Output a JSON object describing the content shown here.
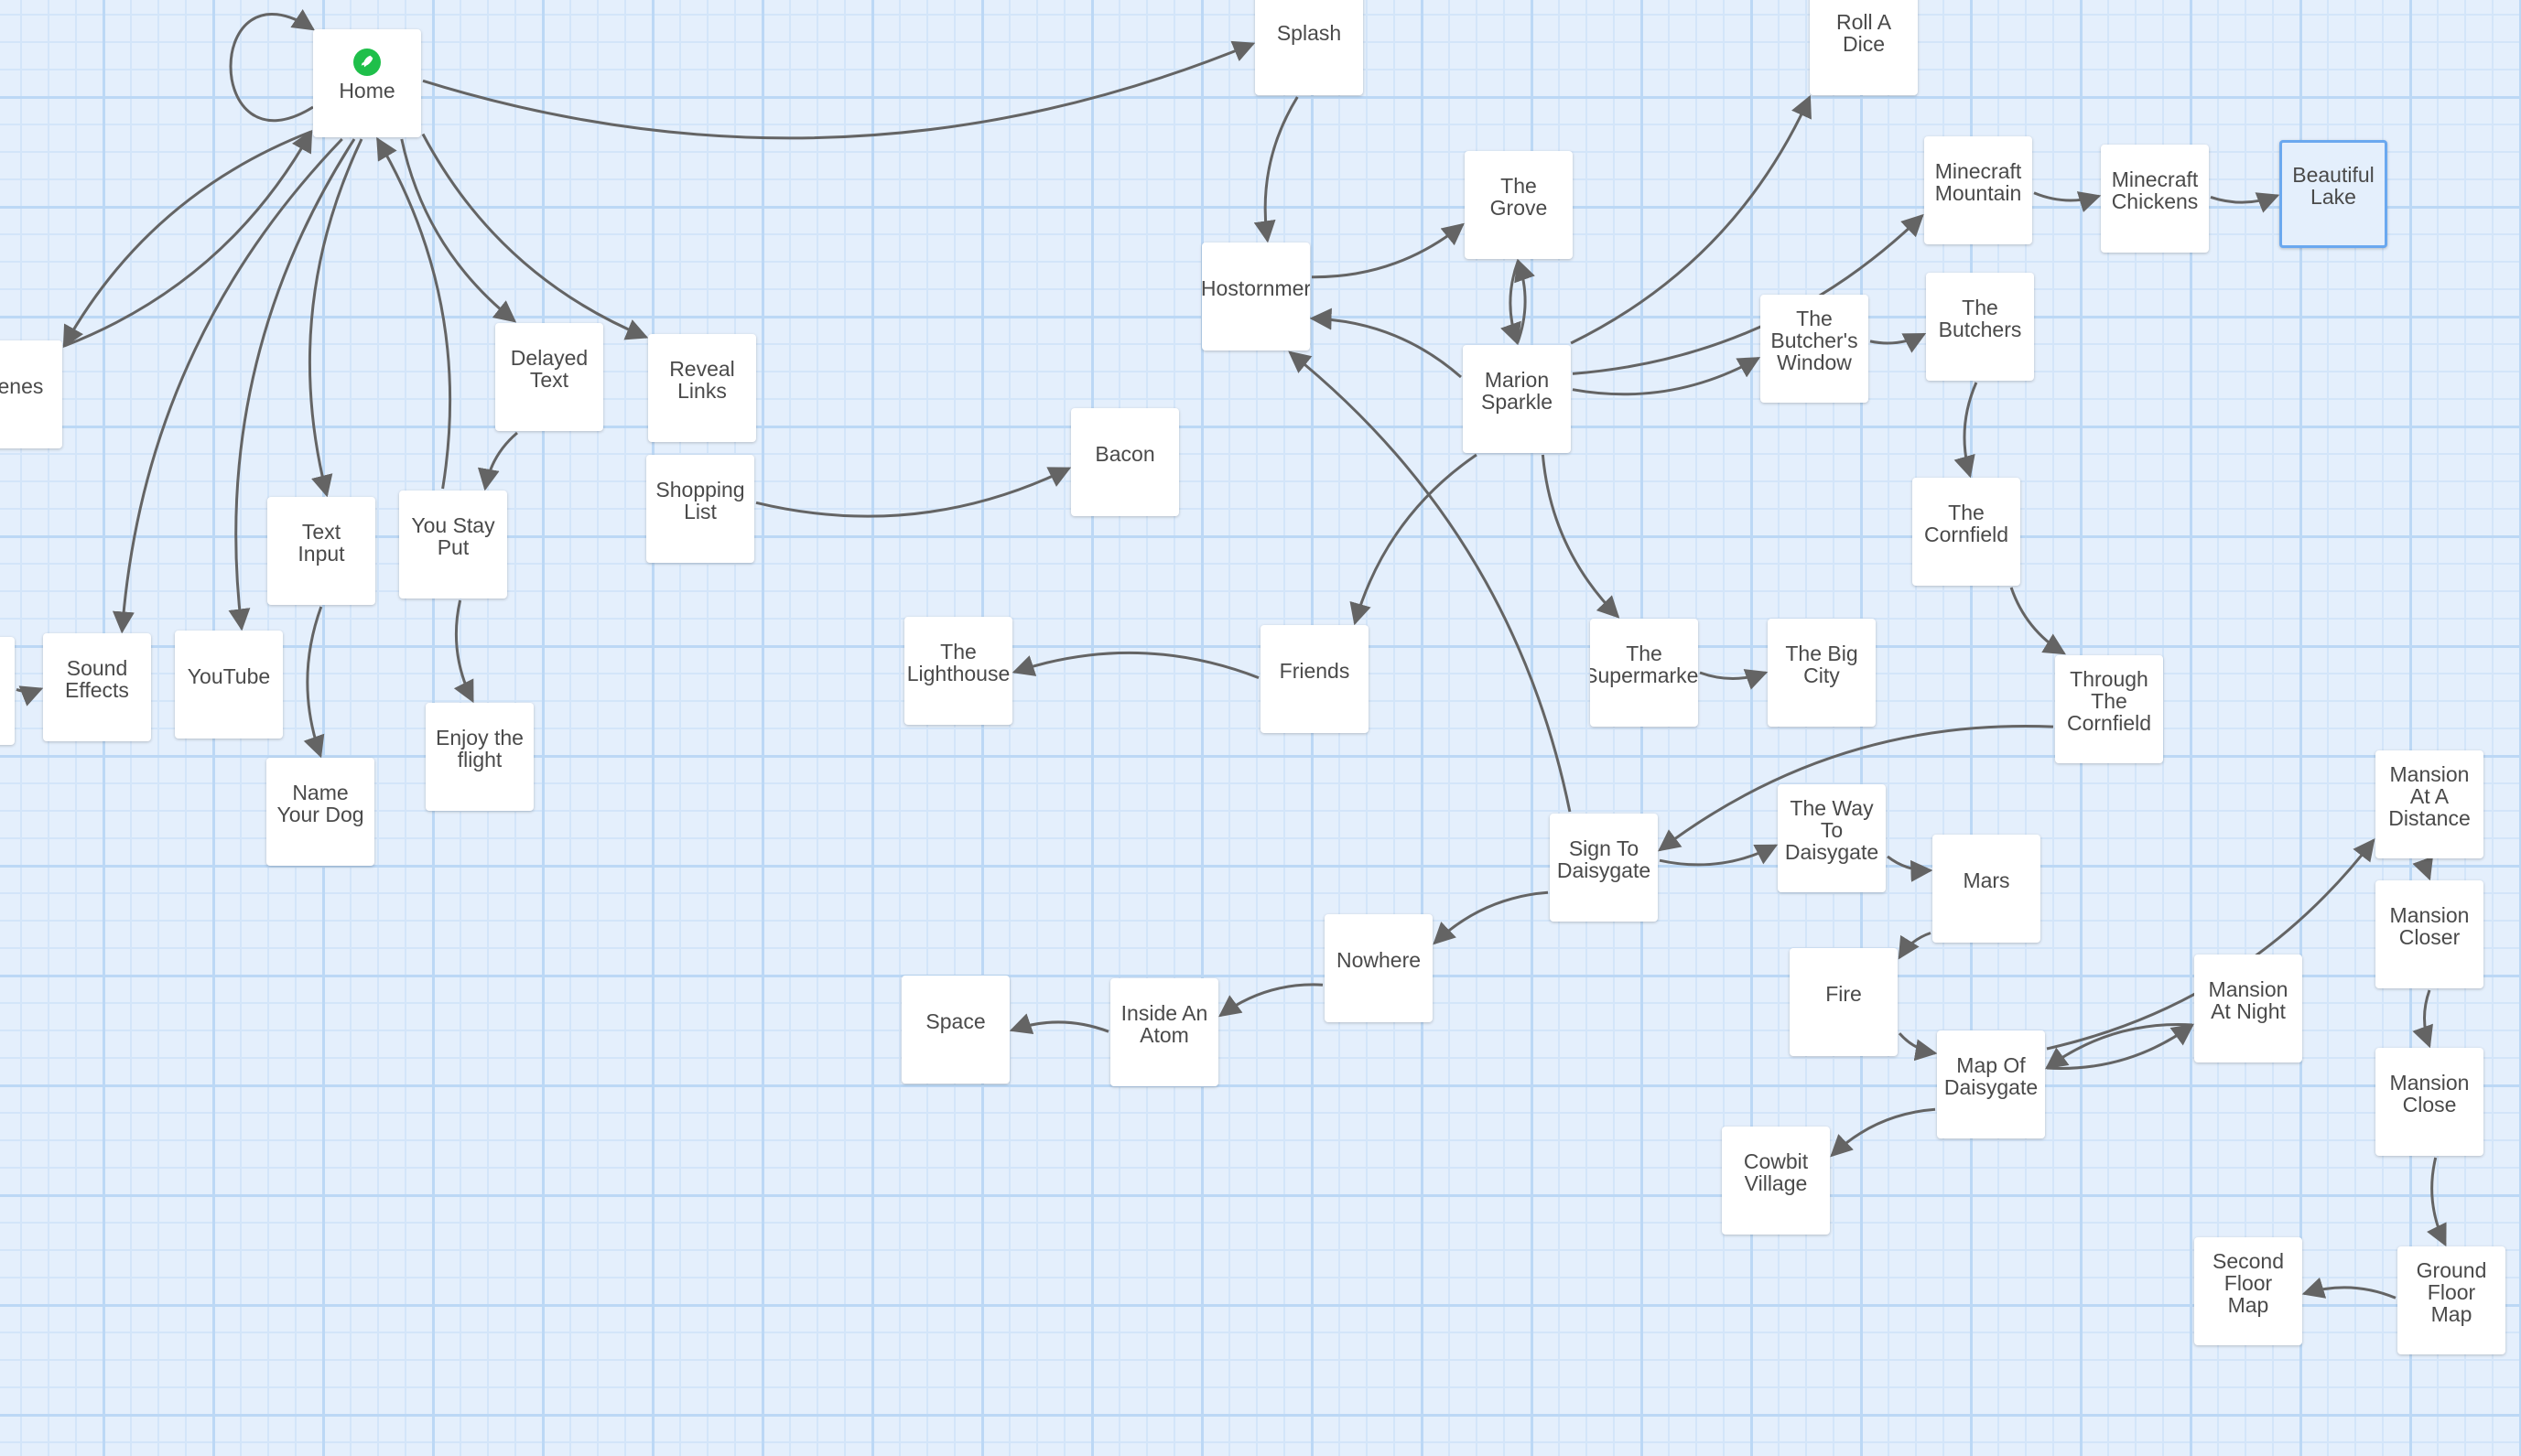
{
  "app": "Twine story map",
  "start_passage": "Home",
  "selected_passage": "Beautiful Lake",
  "colors": {
    "background": "#e4effc",
    "grid_major": "#bcd8f5",
    "grid_minor": "#d3e5f9",
    "node_fill": "#ffffff",
    "node_text": "#4a4a4a",
    "edge": "#646464",
    "selected_border": "#6aa8ef",
    "start_icon": "#1fbf4a"
  },
  "passages": [
    {
      "id": "home",
      "label": "Home",
      "start": true
    },
    {
      "id": "splash",
      "label": "Splash"
    },
    {
      "id": "roll-a-dice",
      "label": "Roll A\nDice"
    },
    {
      "id": "the-grove",
      "label": "The\nGrove"
    },
    {
      "id": "hostornme",
      "label": "Hostornmer"
    },
    {
      "id": "minecraft-mountain",
      "label": "Minecraft\nMountain"
    },
    {
      "id": "minecraft-chickens",
      "label": "Minecraft\nChickens"
    },
    {
      "id": "beautiful-lake",
      "label": "Beautiful\nLake",
      "selected": true
    },
    {
      "id": "marion-sparkle",
      "label": "Marion\nSparkle"
    },
    {
      "id": "butchers-window",
      "label": "The\nButcher's\nWindow"
    },
    {
      "id": "the-butchers",
      "label": "The\nButchers"
    },
    {
      "id": "the-cornfield",
      "label": "The\nCornfield"
    },
    {
      "id": "through-the-cornfield",
      "label": "Through\nThe\nCornfield"
    },
    {
      "id": "delayed-text",
      "label": "Delayed\nText"
    },
    {
      "id": "reveal-links",
      "label": "Reveal\nLinks"
    },
    {
      "id": "shopping-list",
      "label": "Shopping\nList"
    },
    {
      "id": "bacon",
      "label": "Bacon"
    },
    {
      "id": "scenes",
      "label": "Scenes"
    },
    {
      "id": "text-input",
      "label": "Text\nInput"
    },
    {
      "id": "you-stay-put",
      "label": "You Stay\nPut"
    },
    {
      "id": "enjoy-the-flight",
      "label": "Enjoy the\nflight"
    },
    {
      "id": "name-your-dog",
      "label": "Name\nYour Dog"
    },
    {
      "id": "sound-effects",
      "label": "Sound\nEffects"
    },
    {
      "id": "youtube",
      "label": "YouTube"
    },
    {
      "id": "left-offscreen",
      "label": ""
    },
    {
      "id": "the-lighthouse",
      "label": "The\nLighthouse"
    },
    {
      "id": "friends",
      "label": "Friends"
    },
    {
      "id": "the-supermarket",
      "label": "The\nSupermarket"
    },
    {
      "id": "the-big-city",
      "label": "The Big\nCity"
    },
    {
      "id": "sign-to-daisygate",
      "label": "Sign To\nDaisygate"
    },
    {
      "id": "way-to-daisygate",
      "label": "The Way\nTo\nDaisygate"
    },
    {
      "id": "mars",
      "label": "Mars"
    },
    {
      "id": "nowhere",
      "label": "Nowhere"
    },
    {
      "id": "inside-an-atom",
      "label": "Inside An\nAtom"
    },
    {
      "id": "space",
      "label": "Space"
    },
    {
      "id": "fire",
      "label": "Fire"
    },
    {
      "id": "map-of-daisygate",
      "label": "Map Of\nDaisygate"
    },
    {
      "id": "mansion-at-night",
      "label": "Mansion\nAt Night"
    },
    {
      "id": "cowbit-village",
      "label": "Cowbit\nVillage"
    },
    {
      "id": "mansion-at-a-distance",
      "label": "Mansion\nAt A\nDistance"
    },
    {
      "id": "mansion-closer",
      "label": "Mansion\nCloser"
    },
    {
      "id": "mansion-close",
      "label": "Mansion\nClose"
    },
    {
      "id": "second-floor-map",
      "label": "Second\nFloor\nMap"
    },
    {
      "id": "ground-floor-map",
      "label": "Ground\nFloor\nMap"
    }
  ],
  "links": [
    {
      "from": "home",
      "to": "home"
    },
    {
      "from": "home",
      "to": "splash"
    },
    {
      "from": "home",
      "to": "scenes"
    },
    {
      "from": "home",
      "to": "delayed-text"
    },
    {
      "from": "home",
      "to": "reveal-links"
    },
    {
      "from": "home",
      "to": "text-input"
    },
    {
      "from": "home",
      "to": "sound-effects"
    },
    {
      "from": "home",
      "to": "youtube"
    },
    {
      "from": "you-stay-put",
      "to": "home"
    },
    {
      "from": "scenes",
      "to": "home"
    },
    {
      "from": "delayed-text",
      "to": "you-stay-put"
    },
    {
      "from": "you-stay-put",
      "to": "enjoy-the-flight"
    },
    {
      "from": "text-input",
      "to": "name-your-dog"
    },
    {
      "from": "left-offscreen",
      "to": "sound-effects"
    },
    {
      "from": "shopping-list",
      "to": "bacon"
    },
    {
      "from": "splash",
      "to": "hostornme"
    },
    {
      "from": "hostornme",
      "to": "the-grove"
    },
    {
      "from": "marion-sparkle",
      "to": "hostornme"
    },
    {
      "from": "sign-to-daisygate",
      "to": "hostornme"
    },
    {
      "from": "the-grove",
      "to": "marion-sparkle"
    },
    {
      "from": "marion-sparkle",
      "to": "the-grove"
    },
    {
      "from": "marion-sparkle",
      "to": "roll-a-dice"
    },
    {
      "from": "marion-sparkle",
      "to": "minecraft-mountain"
    },
    {
      "from": "marion-sparkle",
      "to": "butchers-window"
    },
    {
      "from": "marion-sparkle",
      "to": "friends"
    },
    {
      "from": "marion-sparkle",
      "to": "the-supermarket"
    },
    {
      "from": "minecraft-mountain",
      "to": "minecraft-chickens"
    },
    {
      "from": "minecraft-chickens",
      "to": "beautiful-lake"
    },
    {
      "from": "butchers-window",
      "to": "the-butchers"
    },
    {
      "from": "the-butchers",
      "to": "the-cornfield"
    },
    {
      "from": "the-cornfield",
      "to": "through-the-cornfield"
    },
    {
      "from": "through-the-cornfield",
      "to": "sign-to-daisygate"
    },
    {
      "from": "the-supermarket",
      "to": "the-big-city"
    },
    {
      "from": "friends",
      "to": "the-lighthouse"
    },
    {
      "from": "sign-to-daisygate",
      "to": "way-to-daisygate"
    },
    {
      "from": "sign-to-daisygate",
      "to": "nowhere"
    },
    {
      "from": "way-to-daisygate",
      "to": "mars"
    },
    {
      "from": "mars",
      "to": "fire"
    },
    {
      "from": "fire",
      "to": "map-of-daisygate"
    },
    {
      "from": "nowhere",
      "to": "inside-an-atom"
    },
    {
      "from": "inside-an-atom",
      "to": "space"
    },
    {
      "from": "map-of-daisygate",
      "to": "mansion-at-night"
    },
    {
      "from": "mansion-at-night",
      "to": "map-of-daisygate"
    },
    {
      "from": "map-of-daisygate",
      "to": "cowbit-village"
    },
    {
      "from": "map-of-daisygate",
      "to": "mansion-at-a-distance"
    },
    {
      "from": "mansion-at-a-distance",
      "to": "mansion-closer"
    },
    {
      "from": "mansion-closer",
      "to": "mansion-close"
    },
    {
      "from": "mansion-close",
      "to": "ground-floor-map"
    },
    {
      "from": "ground-floor-map",
      "to": "second-floor-map"
    }
  ]
}
